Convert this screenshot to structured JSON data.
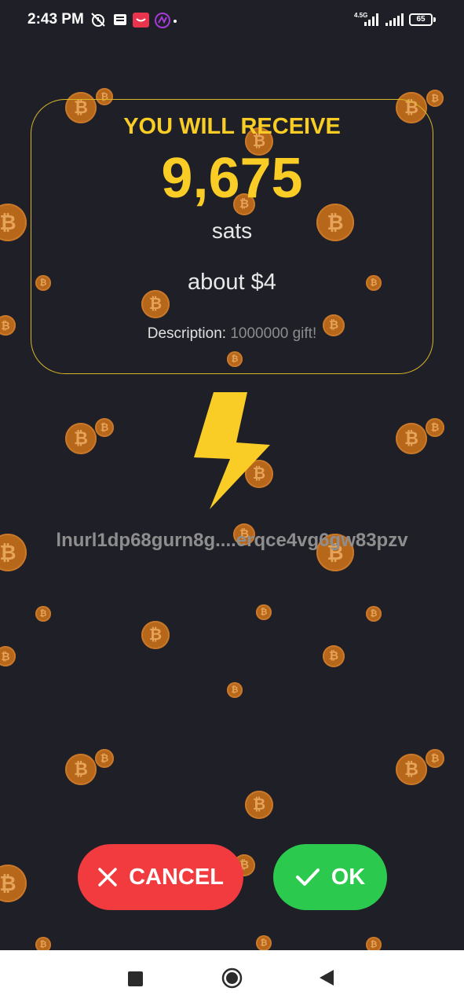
{
  "status_bar": {
    "time": "2:43 PM",
    "network": "4.5G",
    "battery": "65",
    "icons": [
      "alarm-off-icon",
      "news-icon",
      "app-notification-icon",
      "app-logo-icon",
      "dot-icon",
      "signal-icon",
      "signal-icon-2",
      "battery-icon"
    ]
  },
  "receive": {
    "title": "YOU WILL RECEIVE",
    "amount": "9,675",
    "unit": "sats",
    "fiat": "about $4",
    "description_label": "Description:",
    "description_value": "1000000 gift!"
  },
  "lnurl": "lnurl1dp68gurn8g....erqce4vg6gw83pzv",
  "buttons": {
    "cancel": "CANCEL",
    "ok": "OK"
  },
  "colors": {
    "background": "#1f2027",
    "accent": "#f9cd26",
    "cancel": "#f23b3f",
    "ok": "#2cc94f",
    "coin": "#b7671a"
  },
  "nav": {
    "icons": [
      "recents-icon",
      "home-icon",
      "back-icon"
    ]
  }
}
